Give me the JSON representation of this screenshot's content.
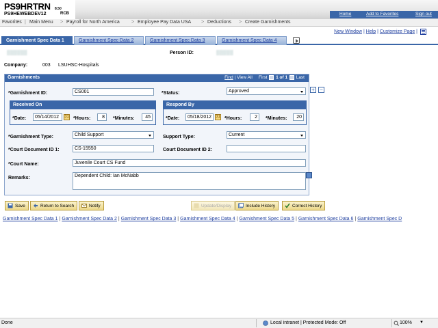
{
  "header": {
    "title": "PS9HRTRN",
    "version": "8.50",
    "subtitle": "PS9HEWEBDEV12",
    "suffix": "RCB",
    "links": [
      "Home",
      "Add to Favorites",
      "Sign out"
    ]
  },
  "breadcrumb": [
    "Favorites",
    "Main Menu",
    "Payroll for North America",
    "Employee Pay Data USA",
    "Deductions",
    "Create Garnishments"
  ],
  "utility": {
    "new_window": "New Window",
    "help": "Help",
    "customize": "Customize Page"
  },
  "tabs": [
    "Garnishment Spec Data 1",
    "Garnishment Spec Data 2",
    "Garnishment Spec Data 3",
    "Garnishment Spec Data 4"
  ],
  "person": {
    "label": "Person ID:",
    "company_label": "Company:",
    "company_code": "003",
    "company_name": "LSUHSC-Hospitals"
  },
  "garnishments": {
    "title": "Garnishments",
    "nav": {
      "find": "Find",
      "view_all": "View All",
      "first": "First",
      "position": "1 of 1",
      "last": "Last"
    },
    "garnishment_id_label": "*Garnishment ID:",
    "garnishment_id": "CS001",
    "status_label": "*Status:",
    "status": "Approved",
    "received": {
      "title": "Received On",
      "date_label": "*Date:",
      "date": "05/14/2012",
      "hours_label": "*Hours:",
      "hours": "8",
      "minutes_label": "*Minutes:",
      "minutes": "45"
    },
    "respond": {
      "title": "Respond By",
      "date_label": "*Date:",
      "date": "05/18/2012",
      "hours_label": "*Hours:",
      "hours": "2",
      "minutes_label": "*Minutes:",
      "minutes": "20"
    },
    "type_label": "*Garnishment Type:",
    "type": "Child Support",
    "support_type_label": "Support Type:",
    "support_type": "Current",
    "court_doc1_label": "*Court Document ID 1:",
    "court_doc1": "CS-15550",
    "court_doc2_label": "Court Document ID 2:",
    "court_doc2": "",
    "court_name_label": "*Court Name:",
    "court_name": "Juvenile Court CS Fund",
    "remarks_label": "Remarks:",
    "remarks": "Dependent Child: Ian McNabb"
  },
  "buttons": {
    "save": "Save",
    "return": "Return to Search",
    "notify": "Notify",
    "update": "Update/Display",
    "include_history": "Include History",
    "correct_history": "Correct History"
  },
  "bottom_links": [
    "Garnishment Spec Data 1",
    "Garnishment Spec Data 2",
    "Garnishment Spec Data 3",
    "Garnishment Spec Data 4",
    "Garnishment Spec Data 5",
    "Garnishment Spec Data 6",
    "Garnishment Spec D"
  ],
  "status_bar": {
    "left": "Done",
    "zone": "Local intranet | Protected Mode: Off",
    "zoom": "100%"
  }
}
